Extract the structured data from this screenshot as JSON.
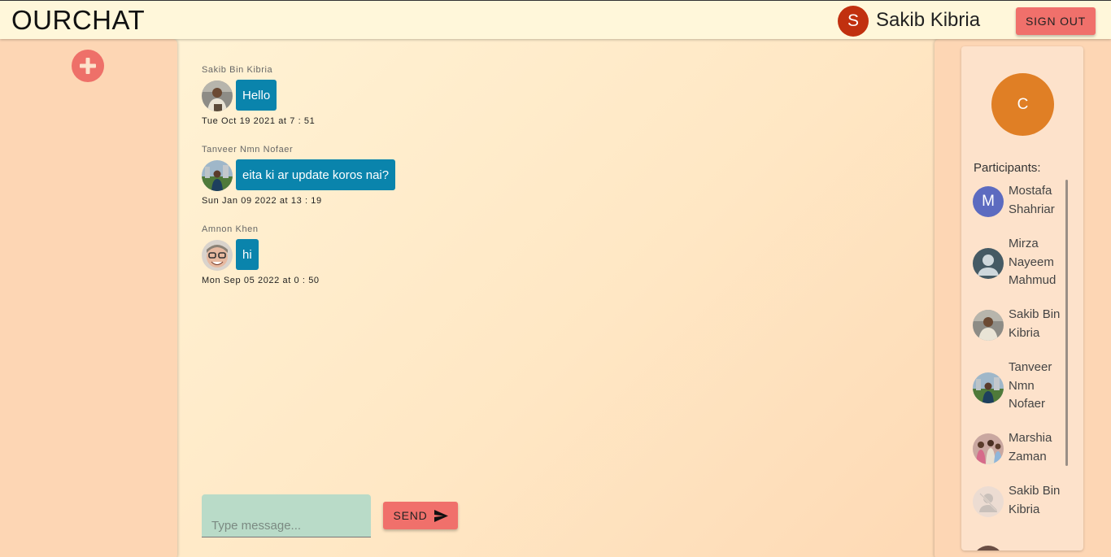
{
  "header": {
    "brand": "OURCHAT",
    "user_initial": "S",
    "user_name": "Sakib Kibria",
    "signout_label": "SIGN OUT"
  },
  "sidebar": {
    "add_icon": "plus-icon"
  },
  "chat": {
    "messages": [
      {
        "sender": "Sakib Bin Kibria",
        "text": "Hello",
        "time": "Tue Oct 19 2021 at 7 : 51"
      },
      {
        "sender": "Tanveer Nmn Nofaer",
        "text": "eita ki ar update koros nai?",
        "time": "Sun Jan 09 2022 at 13 : 19"
      },
      {
        "sender": "Amnon Khen",
        "text": "hi",
        "time": "Mon Sep 05 2022 at 0 : 50"
      }
    ],
    "input_placeholder": "Type message...",
    "send_label": "SEND"
  },
  "room": {
    "initial": "C",
    "participants_label": "Participants:",
    "participants": [
      {
        "name": "Mostafa Shahriar",
        "initial": "M"
      },
      {
        "name": "Mirza Nayeem Mahmud"
      },
      {
        "name": "Sakib Bin Kibria"
      },
      {
        "name": "Tanveer Nmn Nofaer"
      },
      {
        "name": "Marshia Zaman"
      },
      {
        "name": "Sakib Bin Kibria"
      }
    ]
  },
  "colors": {
    "accent": "#f0706b",
    "bubble": "#0a84ac",
    "room_avatar": "#e07f25",
    "user_avatar": "#c1300f"
  }
}
